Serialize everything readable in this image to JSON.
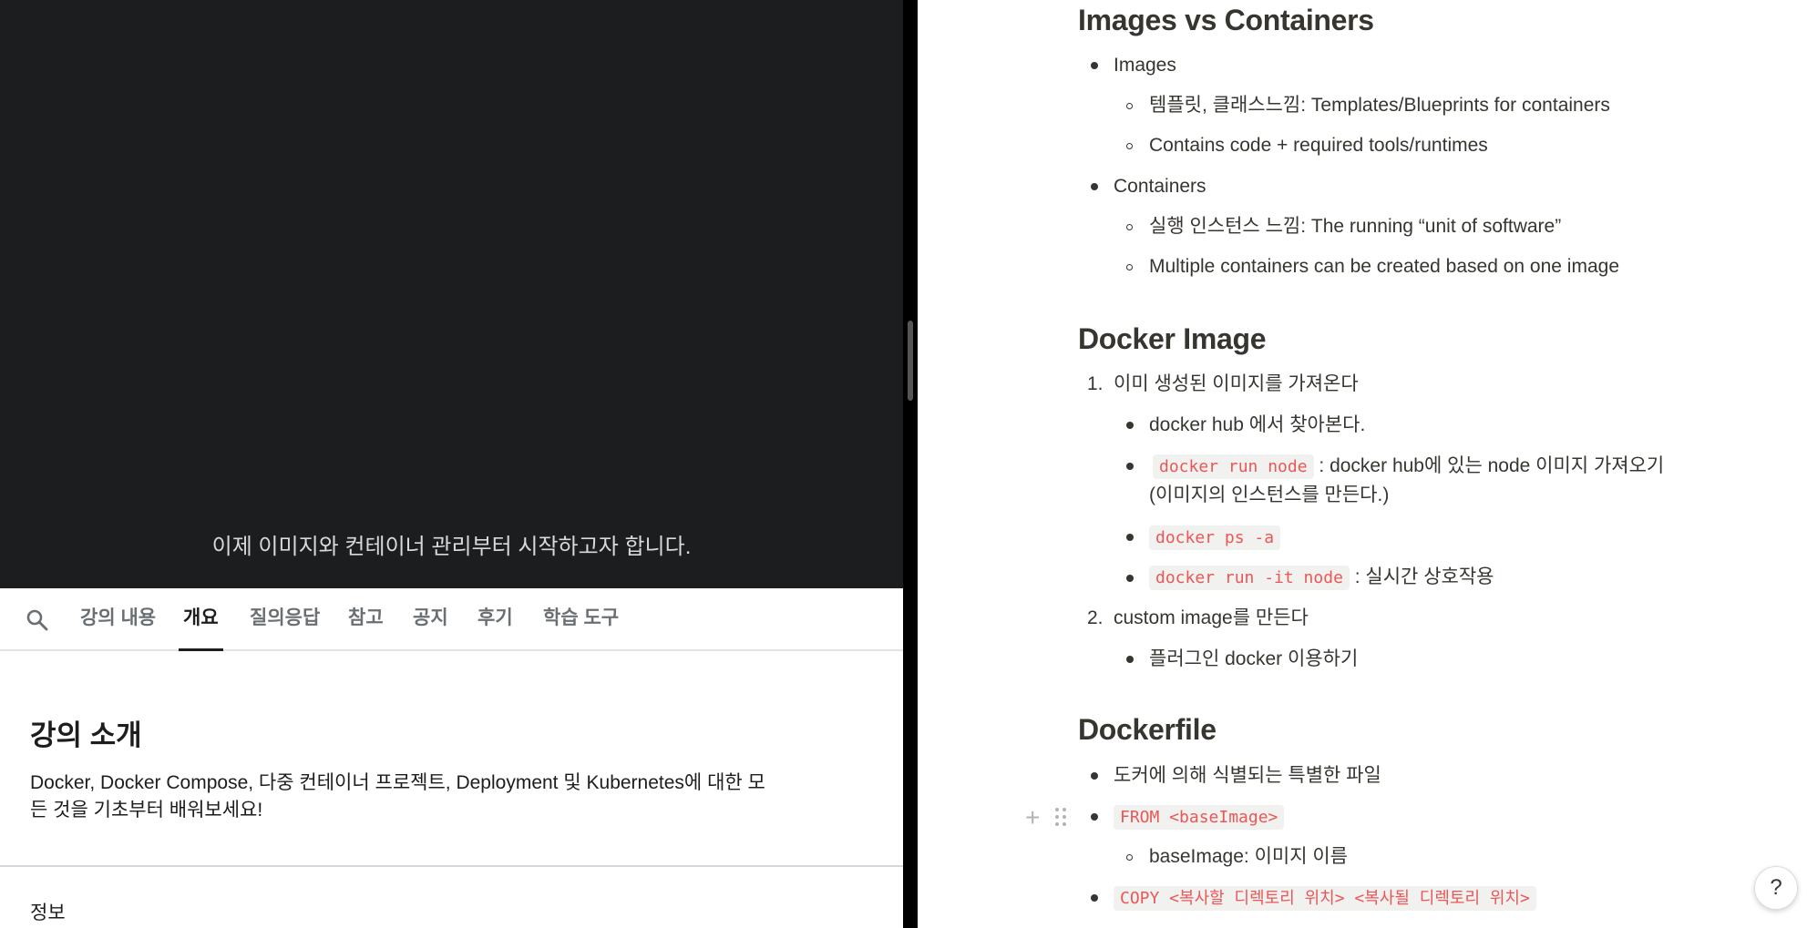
{
  "video": {
    "subtitle": "이제 이미지와 컨테이너 관리부터 시작하고자 합니다."
  },
  "tabs": [
    {
      "label": "강의 내용"
    },
    {
      "label": "개요"
    },
    {
      "label": "질의응답"
    },
    {
      "label": "참고"
    },
    {
      "label": "공지"
    },
    {
      "label": "후기"
    },
    {
      "label": "학습 도구"
    }
  ],
  "active_tab": "개요",
  "intro": {
    "title": "강의 소개",
    "description": "Docker, Docker Compose, 다중 컨테이너 프로젝트, Deployment 및 Kubernetes에 대한 모든 것을 기초부터 배워보세요!",
    "info_label": "정보"
  },
  "notes": {
    "images_vs_containers": {
      "heading": "Images vs Containers",
      "images": "Images",
      "images_sub1": "템플릿, 클래스느낌: Templates/Blueprints for containers",
      "images_sub2": "Contains code + required tools/runtimes",
      "containers": "Containers",
      "containers_sub1": "실행 인스턴스 느낌: The running “unit of software”",
      "containers_sub2": "Multiple containers can be created based on one image"
    },
    "docker_image": {
      "heading": "Docker Image",
      "step1_num": "1.",
      "step1": "이미 생성된 이미지를 가져온다",
      "step1_b1": "docker hub 에서 찾아본다.",
      "step1_b2_code": "docker run node",
      "step1_b2_text": ": docker hub에 있는 node 이미지 가져오기",
      "step1_b2_text2": "(이미지의 인스턴스를 만든다.)",
      "step1_b3_code": "docker ps -a",
      "step1_b4_code": "docker run -it node",
      "step1_b4_text": ": 실시간 상호작용",
      "step2_num": "2.",
      "step2": "custom image를 만든다",
      "step2_b1": "플러그인 docker 이용하기"
    },
    "dockerfile": {
      "heading": "Dockerfile",
      "b1": "도커에 의해 식별되는 특별한 파일",
      "b2_code": "FROM <baseImage>",
      "b2_sub": "baseImage: 이미지 이름",
      "b3_code": "COPY <복사할 디렉토리 위치> <복사될 디렉토리 위치>"
    }
  },
  "help_label": "?",
  "plus_label": "+"
}
